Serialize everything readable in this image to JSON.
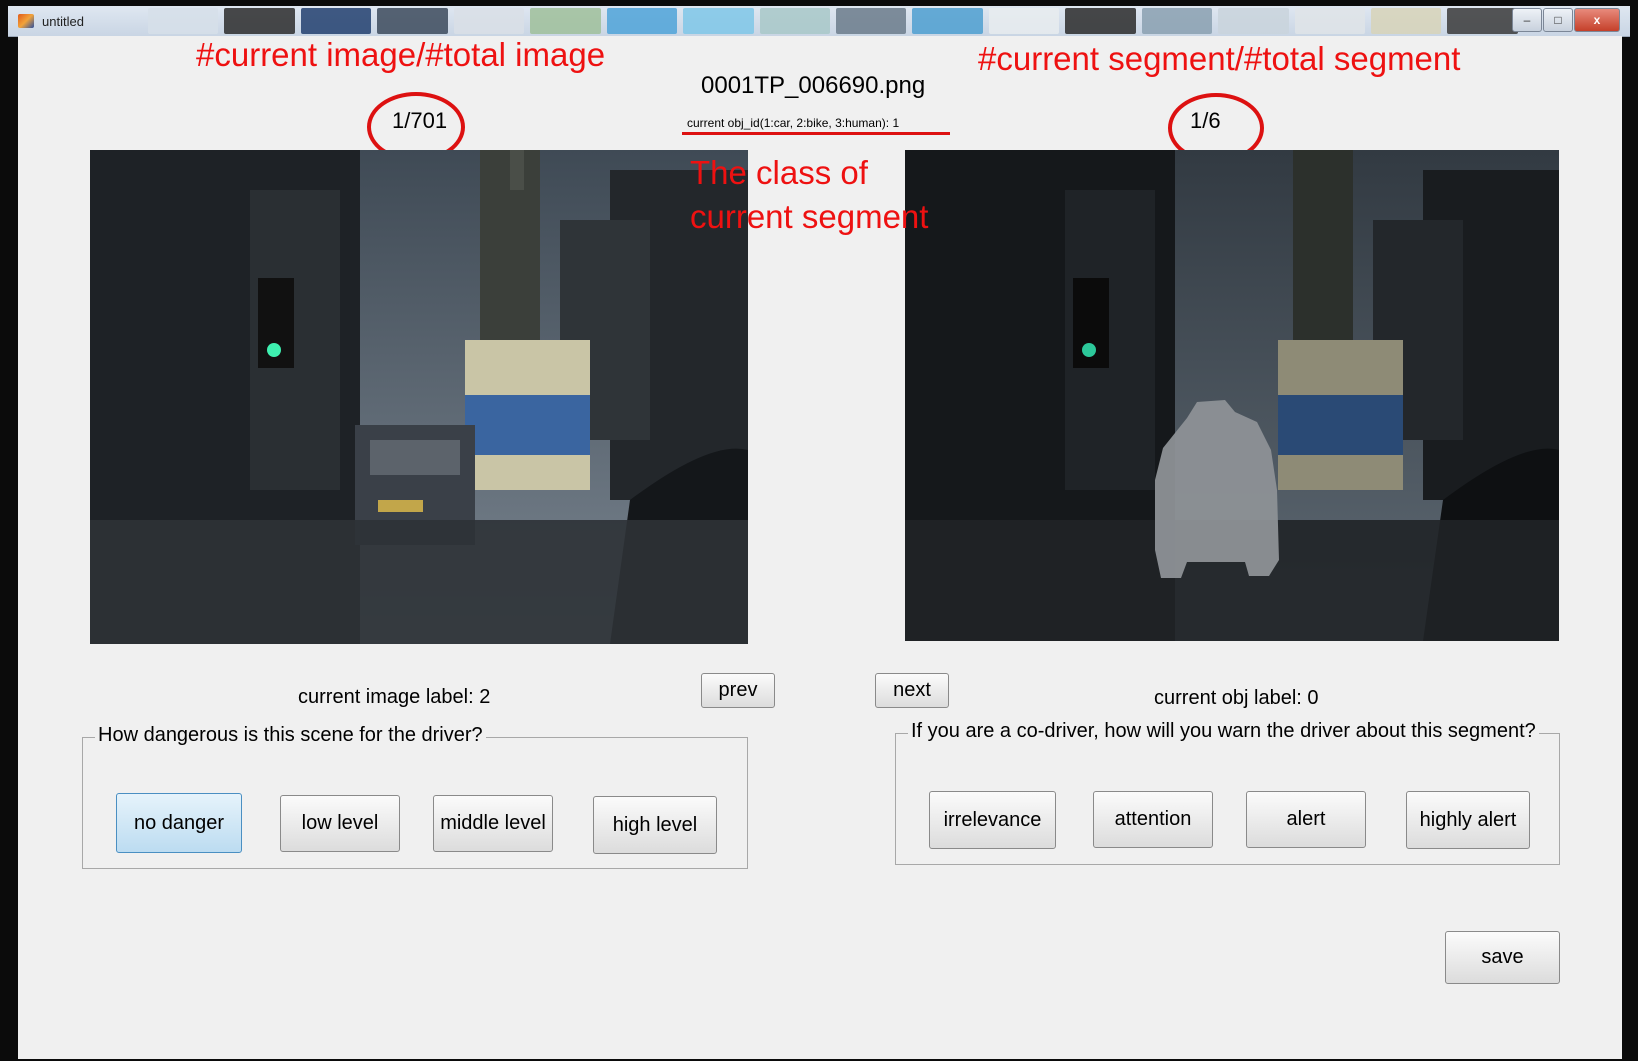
{
  "window": {
    "title": "untitled",
    "controls": {
      "minimize": "–",
      "maximize": "□",
      "close": "x"
    }
  },
  "annotations": {
    "image_counter_caption": "#current image/#total image",
    "segment_counter_caption": "#current segment/#total segment",
    "segment_class_caption_line1": "The class of",
    "segment_class_caption_line2": "current segment",
    "highlight_color": "#dd1111"
  },
  "header": {
    "filename": "0001TP_006690.png",
    "image_counter": "1/701",
    "segment_counter": "1/6",
    "obj_id_text": "current obj_id(1:car, 2:bike, 3:human): 1"
  },
  "images": {
    "left": {
      "description": "street-scene-photo"
    },
    "right": {
      "description": "street-scene-photo-with-highlighted-car-segment"
    }
  },
  "status": {
    "image_label": "current image label: 2",
    "obj_label": "current obj label: 0"
  },
  "nav": {
    "prev": "prev",
    "next": "next"
  },
  "scene_group": {
    "legend": "How dangerous is this scene for the driver?",
    "options": [
      "no danger",
      "low level",
      "middle level",
      "high level"
    ],
    "selected": "no danger"
  },
  "segment_group": {
    "legend": "If you are a co-driver, how will you warn the driver about this segment?",
    "options": [
      "irrelevance",
      "attention",
      "alert",
      "highly alert"
    ]
  },
  "save_label": "save",
  "colors": {
    "selected_button": "#bcdcf1",
    "window_bg": "#f0f0f0"
  }
}
